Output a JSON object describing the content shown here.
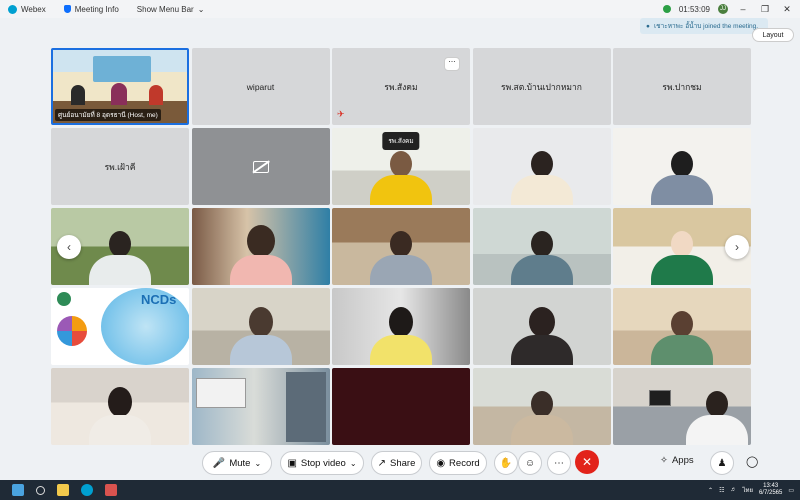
{
  "titlebar": {
    "app_name": "Webex",
    "meeting_info": "Meeting Info",
    "show_menu_bar": "Show Menu Bar",
    "timer": "01:53:09",
    "user_initials": "JJ"
  },
  "notification": {
    "text": "เชาะหาพะ อั้น้ำบ joined the meeting."
  },
  "layout_button": {
    "label": "Layout"
  },
  "tiles": [
    {
      "label": "ศูนย์อนามัยที่ 8 อุดรธานี (Host, me)",
      "type": "video-host"
    },
    {
      "label": "wiparut",
      "type": "name"
    },
    {
      "label": "รพ.สังคม",
      "type": "name-muted"
    },
    {
      "label": "รพ.สต.บ้านเปากหมาก",
      "type": "name"
    },
    {
      "label": "รพ.ปากชม",
      "type": "name"
    },
    {
      "label": "รพ.เฝ้าคี",
      "type": "name"
    },
    {
      "label": "",
      "type": "camera-off"
    },
    {
      "label": "รพ.สังคม",
      "type": "video-pill"
    },
    {
      "label": "",
      "type": "video"
    },
    {
      "label": "",
      "type": "video"
    },
    {
      "label": "",
      "type": "video"
    },
    {
      "label": "",
      "type": "video"
    },
    {
      "label": "",
      "type": "video"
    },
    {
      "label": "",
      "type": "video"
    },
    {
      "label": "",
      "type": "video"
    },
    {
      "label": "NCDs",
      "type": "slide"
    },
    {
      "label": "",
      "type": "video"
    },
    {
      "label": "",
      "type": "video"
    },
    {
      "label": "",
      "type": "video"
    },
    {
      "label": "",
      "type": "video"
    },
    {
      "label": "",
      "type": "video"
    },
    {
      "label": "",
      "type": "video"
    },
    {
      "label": "",
      "type": "dark"
    },
    {
      "label": "",
      "type": "video"
    },
    {
      "label": "",
      "type": "video"
    }
  ],
  "toolbar": {
    "mute": "Mute",
    "stop_video": "Stop video",
    "share": "Share",
    "record": "Record",
    "apps": "Apps"
  },
  "taskbar": {
    "time": "13:43",
    "date": "6/7/2565",
    "lang": "ไทย"
  },
  "colors": {
    "leave": "#e2231a",
    "webex": "#00a0d1",
    "tile_bg": "#d6d7d9"
  }
}
